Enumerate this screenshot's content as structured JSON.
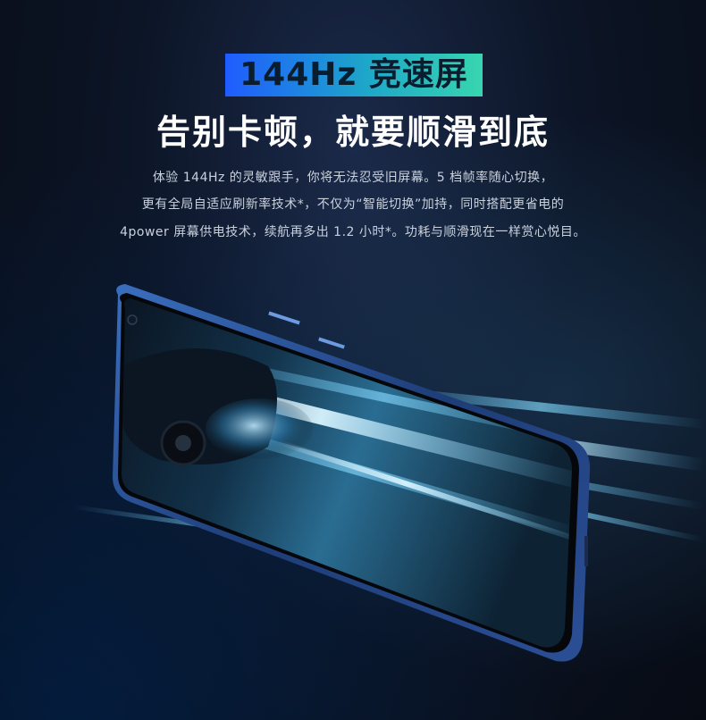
{
  "badge": {
    "text": "144Hz 竞速屏"
  },
  "headline": "告别卡顿，就要顺滑到底",
  "description": {
    "line1": "体验 144Hz 的灵敏跟手，你将无法忍受旧屏幕。5 档帧率随心切换，",
    "line2": "更有全局自适应刷新率技术*，不仅为“智能切换”加持，同时搭配更省电的",
    "line3": "4power 屏幕供电技术，续航再多出 1.2 小时*。功耗与顺滑现在一样赏心悦目。"
  },
  "colors": {
    "badge_gradient_start": "#1f5cff",
    "badge_gradient_end": "#37d6b0",
    "headline": "#ffffff",
    "body_text": "#c9d1dd",
    "phone_frame": "#4a78c8"
  },
  "illustration": {
    "subject": "phone-with-racing-car-screen"
  }
}
